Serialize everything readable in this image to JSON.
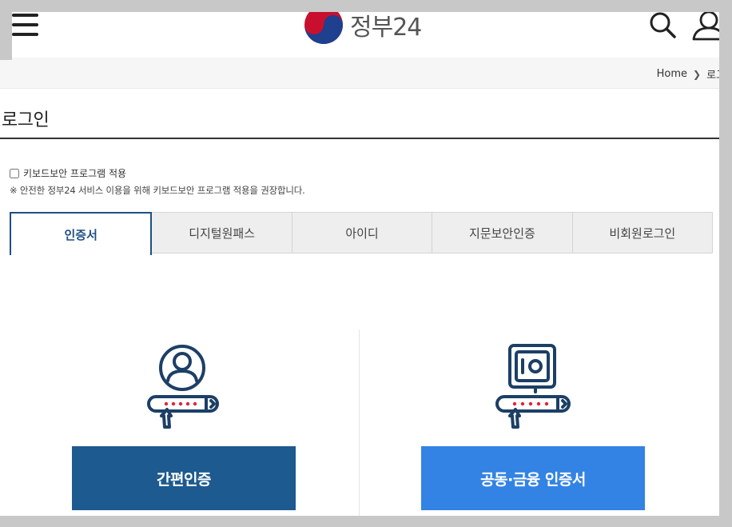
{
  "header": {
    "logo_text": "정부24",
    "menu_icon": "hamburger-menu-icon",
    "search_icon": "search-icon",
    "user_icon": "user-icon"
  },
  "breadcrumb": {
    "home": "Home",
    "current": "로그인"
  },
  "page": {
    "title": "로그인"
  },
  "keyboard_security": {
    "label": "키보드보안 프로그램 적용",
    "checked": false,
    "note": "※ 안전한 정부24 서비스 이용을 위해 키보드보안 프로그램 적용을 권장합니다."
  },
  "tabs": [
    {
      "label": "인증서",
      "active": true
    },
    {
      "label": "디지털원패스",
      "active": false
    },
    {
      "label": "아이디",
      "active": false
    },
    {
      "label": "지문보안인증",
      "active": false
    },
    {
      "label": "비회원로그인",
      "active": false
    }
  ],
  "options": {
    "simple_auth": {
      "label": "간편인증",
      "icon": "person-password-icon",
      "color": "#1d5a8f"
    },
    "joint_cert": {
      "label": "공동·금융 인증서",
      "icon": "safe-password-icon",
      "color": "#3383e4"
    }
  },
  "colors": {
    "accent": "#1d4f84",
    "icon_navy": "#1c3f66",
    "password_dots": "#e0243a"
  }
}
